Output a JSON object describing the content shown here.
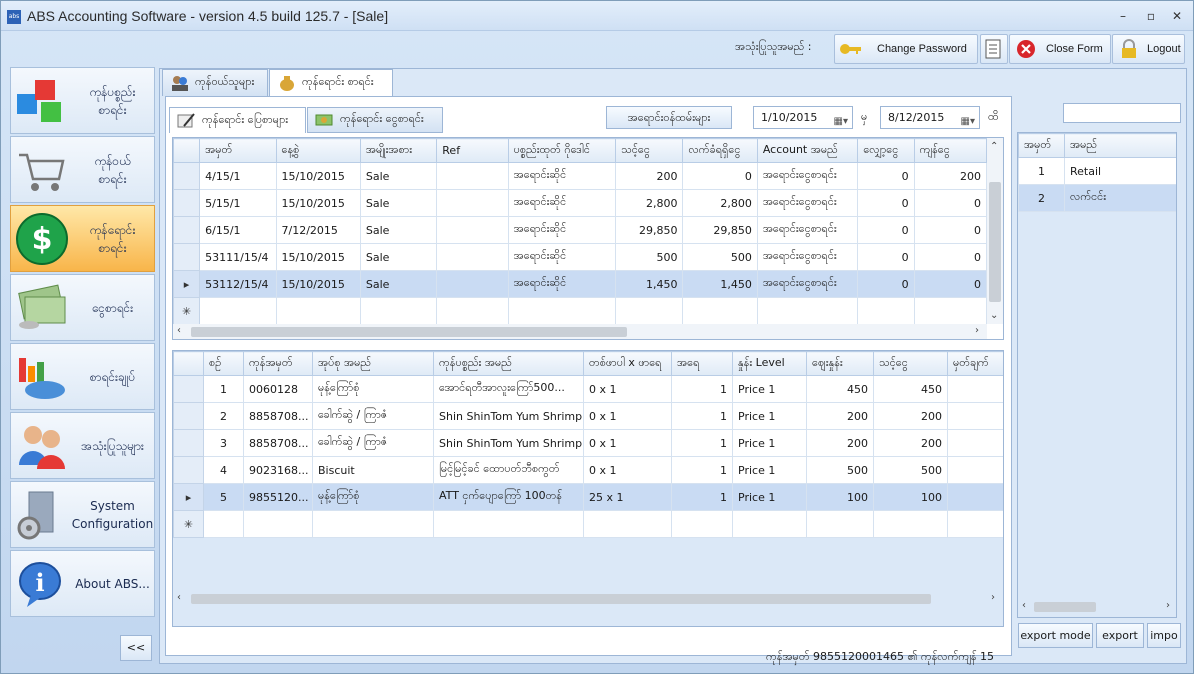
{
  "window": {
    "title": "ABS Accounting Software - version 4.5 build 125.7 - [Sale]",
    "app_icon": "abs"
  },
  "topbar": {
    "user_label": "အသုံးပြုသူအမည် :",
    "change_password": "Change Password",
    "close_form": "Close Form",
    "logout": "Logout"
  },
  "nav": {
    "items": [
      {
        "label": "ကုန်ပစ္စည်း\nစာရင်း",
        "icon": "cubes-icon"
      },
      {
        "label": "ကုန်ဝယ်\nစာရင်း",
        "icon": "cart-icon"
      },
      {
        "label": "ကုန်ရောင်း\nစာရင်း",
        "icon": "dollar-icon"
      },
      {
        "label": "ငွေစာရင်း",
        "icon": "money-icon"
      },
      {
        "label": "စာရင်းချုပ်",
        "icon": "chart-icon"
      },
      {
        "label": "အသုံးပြုသူများ",
        "icon": "users-icon"
      },
      {
        "label": "System\nConfiguration",
        "icon": "settings-icon"
      },
      {
        "label": "About ABS...",
        "icon": "info-icon"
      }
    ],
    "collapse": "<<"
  },
  "tabs": [
    "ကုန်ဝယ်သူများ",
    "ကုန်ရောင်း စာရင်း"
  ],
  "subtabs": [
    "ကုန်ရောင်း ပြေစာများ",
    "ကုန်ရောင်း ငွေစာရင်း"
  ],
  "filter": {
    "button": "အရောင်းဝန်ထမ်းများ",
    "from": "1/10/2015",
    "to_label": "မှ",
    "to": "8/12/2015",
    "until_label": "ထိ"
  },
  "invoices": {
    "columns": [
      "အမှတ်",
      "နေ့စွဲ",
      "အမျိုးအစား",
      "Ref",
      "ပစ္စည်းထုတ် ဂိုဒေါင်",
      "သင့်ငွေ",
      "လက်ခံရရှိငွေ",
      "Account အမည်",
      "လျှော့ငွေ",
      "ကျန်ငွေ"
    ],
    "rows": [
      [
        "4/15/1",
        "15/10/2015",
        "Sale",
        "",
        "အရောင်းဆိုင်",
        "200",
        "0",
        "အရောင်းငွေစာရင်း",
        "0",
        "200"
      ],
      [
        "5/15/1",
        "15/10/2015",
        "Sale",
        "",
        "အရောင်းဆိုင်",
        "2,800",
        "2,800",
        "အရောင်းငွေစာရင်း",
        "0",
        "0"
      ],
      [
        "6/15/1",
        "7/12/2015",
        "Sale",
        "",
        "အရောင်းဆိုင်",
        "29,850",
        "29,850",
        "အရောင်းငွေစာရင်း",
        "0",
        "0"
      ],
      [
        "53111/15/4",
        "15/10/2015",
        "Sale",
        "",
        "အရောင်းဆိုင်",
        "500",
        "500",
        "အရောင်းငွေစာရင်း",
        "0",
        "0"
      ],
      [
        "53112/15/4",
        "15/10/2015",
        "Sale",
        "",
        "အရောင်းဆိုင်",
        "1,450",
        "1,450",
        "အရောင်းငွေစာရင်း",
        "0",
        "0"
      ]
    ],
    "selected_row": 4
  },
  "items": {
    "columns": [
      "စဉ်",
      "ကုန်အမှတ်",
      "အုပ်စု အမည်",
      "ကုန်ပစ္စည်း အမည်",
      "တစ်ဖာပါ x ဖာရေ",
      "အရေ",
      "နှုန်း Level",
      "ဈေးနှုန်း",
      "သင့်ငွေ",
      "မှတ်ချက်"
    ],
    "rows": [
      [
        "1",
        "0060128",
        "မုန့်ကြော်စုံ",
        "အောင်ရတီအာလူးကြော်500...",
        "0 x 1",
        "1",
        "Price 1",
        "450",
        "450",
        ""
      ],
      [
        "2",
        "8858708...",
        "ခေါက်ဆွဲ / ကြာဇံ",
        "Shin ShinTom Yum Shrimp",
        "0 x 1",
        "1",
        "Price 1",
        "200",
        "200",
        ""
      ],
      [
        "3",
        "8858708...",
        "ခေါက်ဆွဲ / ကြာဇံ",
        "Shin ShinTom Yum Shrimp",
        "0 x 1",
        "1",
        "Price 1",
        "200",
        "200",
        ""
      ],
      [
        "4",
        "9023168...",
        "Biscuit",
        "မြင့်မြင့်ခင် ထောပတ်ဘီစကွတ်",
        "0 x 1",
        "1",
        "Price 1",
        "500",
        "500",
        ""
      ],
      [
        "5",
        "9855120...",
        "မုန့်ကြော်စုံ",
        "ATT ငှက်ပျောကြော် 100တန်",
        "25 x 1",
        "1",
        "Price 1",
        "100",
        "100",
        ""
      ]
    ],
    "selected_row": 4
  },
  "status_text": "ကုန်အမှတ် 9855120001465 ၏ ကုန်လက်ကျန် 15",
  "customers": {
    "columns": [
      "အမှတ်",
      "အမည်"
    ],
    "rows": [
      [
        "1",
        "Retail"
      ],
      [
        "2",
        "လက်ငင်း"
      ]
    ],
    "selected_row": 1
  },
  "right_buttons": {
    "export_mode": "export mode",
    "export": "export",
    "import": "impo"
  }
}
